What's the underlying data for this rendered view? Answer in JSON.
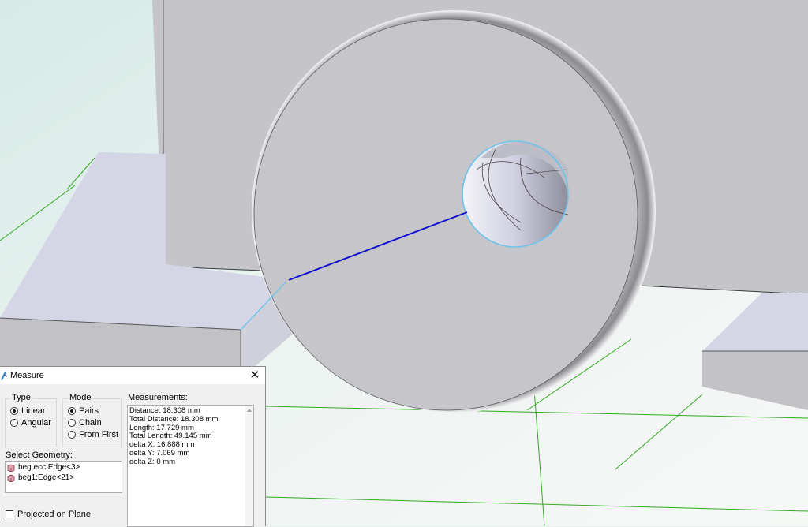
{
  "dialog": {
    "title": "Measure",
    "close_glyph": "✕",
    "icons": {
      "title": "measure-caliper-icon",
      "close": "close-icon",
      "selection": "face-selection-icon"
    },
    "type_group": {
      "label": "Type",
      "options": [
        {
          "label": "Linear",
          "selected": true
        },
        {
          "label": "Angular",
          "selected": false
        }
      ]
    },
    "mode_group": {
      "label": "Mode",
      "options": [
        {
          "label": "Pairs",
          "selected": true
        },
        {
          "label": "Chain",
          "selected": false
        },
        {
          "label": "From First",
          "selected": false
        }
      ]
    },
    "measurements": {
      "label": "Measurements:",
      "lines": [
        "Distance: 18.308 mm",
        "Total Distance: 18.308 mm",
        "Length: 17.729 mm",
        "Total Length: 49.145 mm",
        "delta X: 16.888 mm",
        "delta Y: 7.069 mm",
        "delta Z: 0 mm"
      ]
    },
    "selection": {
      "label": "Select Geometry:",
      "items": [
        "beg ecc:Edge<3>",
        "beg1:Edge<21>"
      ]
    },
    "projected_on_plane": {
      "label": "Projected on Plane",
      "checked": false
    }
  },
  "colors": {
    "measure_line": "#1010d0",
    "grid_line": "#33aa22",
    "hole_highlight": "#6ec3ec",
    "model_face": "#c6c6ca",
    "background": "#e9f1ee"
  }
}
